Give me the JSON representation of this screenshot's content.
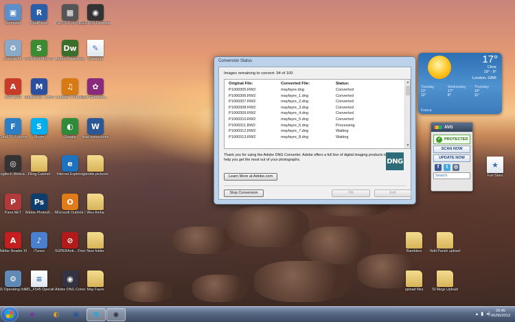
{
  "desktop": {
    "icons": [
      {
        "label": "Computer",
        "glyph": "▣",
        "color": "#5b8fc9"
      },
      {
        "label": "RealPlayer",
        "glyph": "R",
        "color": "#2b5ea8"
      },
      {
        "label": "PHOTOS on SKY IF",
        "glyph": "▦",
        "color": "#555"
      },
      {
        "label": "SLOPDX Developer ...",
        "glyph": "◉",
        "color": "#333"
      },
      {
        "label": "Recycle Bin",
        "glyph": "♻",
        "color": "#8aa8c8"
      },
      {
        "label": "Serif WebPlus X5",
        "glyph": "S",
        "color": "#3c8a32"
      },
      {
        "label": "Adobe Dreamwea...",
        "glyph": "Dw",
        "color": "#3a6e2a"
      },
      {
        "label": "Drawing1",
        "glyph": "✎",
        "color": "#d9d9d9"
      },
      {
        "label": "AVG 2013",
        "glyph": "A",
        "color": "#c83a2a"
      },
      {
        "label": "Malware­by... Anti-Malw...",
        "glyph": "M",
        "color": "#2a4fa0"
      },
      {
        "label": "Audacity 1.3 Beta (Unic...",
        "glyph": "♫",
        "color": "#d87a14"
      },
      {
        "label": "Pin Gamblem...",
        "glyph": "✿",
        "color": "#8a2a7a"
      },
      {
        "label": "CuteFTP 8 Home",
        "glyph": "F",
        "color": "#2d7fc4"
      },
      {
        "label": "Skype",
        "glyph": "S",
        "color": "#00aff0"
      },
      {
        "label": "Google",
        "glyph": "◐",
        "color": "#2f8a3a"
      },
      {
        "label": "Ipad instructions",
        "glyph": "W",
        "color": "#2b5797"
      },
      {
        "label": "Logitech Webca...",
        "glyph": "◎",
        "color": "#333"
      },
      {
        "label": "Filing Cabinet",
        "glyph": "",
        "color": ""
      },
      {
        "label": "Internet Explorer",
        "glyph": "e",
        "color": "#1e73be"
      },
      {
        "label": "gamble pictures",
        "glyph": "",
        "color": ""
      },
      {
        "label": "Paint.NET",
        "glyph": "P",
        "color": "#b33a3a"
      },
      {
        "label": "Adobe Photosh...",
        "glyph": "Ps",
        "color": "#0f3d6e"
      },
      {
        "label": "Microsoft Outlook 2010",
        "glyph": "O",
        "color": "#e07b1a"
      },
      {
        "label": "Wes Ainha",
        "glyph": "",
        "color": ""
      },
      {
        "label": "Adobe Reader XI",
        "glyph": "A",
        "color": "#c41e1e"
      },
      {
        "label": "iTunes",
        "glyph": "♪",
        "color": "#4a7fd0"
      },
      {
        "label": "SUPERAnti... Free Edition",
        "glyph": "⊘",
        "color": "#b31b1b"
      },
      {
        "label": "New folder",
        "glyph": "",
        "color": ""
      },
      {
        "label": "G5 Operating Instructions",
        "glyph": "⚙",
        "color": "#5f8ab8"
      },
      {
        "label": "SZL_F545 Operating...",
        "glyph": "≡",
        "color": "#d8d8d8"
      },
      {
        "label": "Adobe DNG Converter",
        "glyph": "◉",
        "color": "#334"
      },
      {
        "label": "May Fayre",
        "glyph": "",
        "color": ""
      },
      {
        "label": "Fun Stars",
        "glyph": "★",
        "color": "#cfd8e2"
      },
      {
        "label": "Ramblers",
        "glyph": "",
        "color": ""
      },
      {
        "label": "field Parish upload",
        "glyph": "",
        "color": ""
      },
      {
        "label": "upload files",
        "glyph": "",
        "color": ""
      },
      {
        "label": "St Megs Upload",
        "glyph": "",
        "color": ""
      }
    ]
  },
  "dialog": {
    "title": "Conversion Status",
    "remaining": "Images remaining to convert: 94 of 100",
    "columns": [
      "Original File:",
      "Converted File:",
      "Status:"
    ],
    "rows": [
      [
        "P1000305.RW2",
        "mayfayre.dng",
        "Converted"
      ],
      [
        "P1000306.RW2",
        "mayfayre_1.dng",
        "Converted"
      ],
      [
        "P1000307.RW2",
        "mayfayre_2.dng",
        "Converted"
      ],
      [
        "P1000308.RW2",
        "mayfayre_3.dng",
        "Converted"
      ],
      [
        "P1000309.RW2",
        "mayfayre_4.dng",
        "Converted"
      ],
      [
        "P1000310.RW2",
        "mayfayre_5.dng",
        "Converted"
      ],
      [
        "P1000311.RW2",
        "mayfayre_6.dng",
        "Processing"
      ],
      [
        "P1000312.RW2",
        "mayfayre_7.dng",
        "Waiting"
      ],
      [
        "P1000313.RW2",
        "mayfayre_8.dng",
        "Waiting"
      ]
    ],
    "thanks": "Thank you for using the Adobe DNG Converter. Adobe offers a full line of digital imaging products to help you get the most out of your photographs.",
    "logo_text": "DNG",
    "learn_more": "Learn More at Adobe.com",
    "stop": "Stop Conversion",
    "ok": "OK",
    "exit": "Exit"
  },
  "weather": {
    "temp": "17°",
    "condition": "Clear",
    "range": "18° - 8°",
    "location": "London, GBR",
    "forecast": [
      {
        "day": "Tuesday",
        "hi": "21°",
        "lo": "12°"
      },
      {
        "day": "Wednesday",
        "hi": "17°",
        "lo": "8°"
      },
      {
        "day": "Thursday",
        "hi": "14°",
        "lo": "11°"
      }
    ],
    "provider": "Foreca"
  },
  "avg": {
    "brand": "AVG",
    "status": "PROTECTED",
    "scan": "SCAN NOW",
    "update": "UPDATE NOW",
    "search_placeholder": "Search"
  },
  "taskbar": {
    "items": [
      "e",
      "◐",
      "▣",
      "S",
      "◉"
    ],
    "time": "20:45",
    "date": "06/05/2013"
  }
}
